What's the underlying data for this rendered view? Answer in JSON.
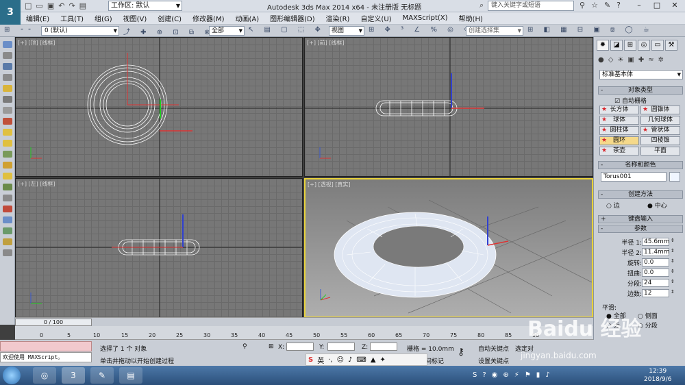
{
  "app": {
    "title": "Autodesk 3ds Max  2014 x64    - 未注册版    无标题",
    "workspace": "工作区: 默认",
    "search_placeholder": "键入关键字或短语"
  },
  "menu": [
    "编辑(E)",
    "工具(T)",
    "组(G)",
    "视图(V)",
    "创建(C)",
    "修改器(M)",
    "动画(A)",
    "图形编辑器(D)",
    "渲染(R)",
    "自定义(U)",
    "MAXScript(X)",
    "帮助(H)"
  ],
  "toolbar": {
    "layer": "0 (默认)",
    "selection_filter": "全部",
    "ref_coord": "视图",
    "named_selection": "创建选择集"
  },
  "viewports": {
    "top": "[+] [顶] [线框]",
    "front": "[+] [前] [线框]",
    "left": "[+] [左] [线框]",
    "persp": "[+] [透视] [真实]"
  },
  "timeline": {
    "frame": "0 / 100",
    "ticks": [
      "0",
      "5",
      "10",
      "15",
      "20",
      "25",
      "30",
      "35",
      "40",
      "45",
      "50",
      "55",
      "60",
      "65",
      "70",
      "75",
      "80",
      "85",
      "90"
    ]
  },
  "status": {
    "selected": "选择了 1 个 对象",
    "prompt": "单击并拖动以开始创建过程",
    "script_welcome": "欢迎使用 MAXScript。",
    "x_label": "X:",
    "y_label": "Y:",
    "z_label": "Z:",
    "grid": "栅格 = 10.0mm",
    "auto_key": "自动关键点",
    "set_key": "设置关键点",
    "selected_set": "选定对",
    "add_time_tag": "添加时间标记"
  },
  "panel": {
    "category": "标准基本体",
    "object_type_title": "对象类型",
    "auto_grid": "自动栅格",
    "object_buttons": [
      {
        "label": "长方体",
        "active": false
      },
      {
        "label": "圆锥体",
        "active": false
      },
      {
        "label": "球体",
        "active": false
      },
      {
        "label": "几何球体",
        "active": false
      },
      {
        "label": "圆柱体",
        "active": false
      },
      {
        "label": "管状体",
        "active": false
      },
      {
        "label": "圆环",
        "active": true
      },
      {
        "label": "四棱锥",
        "active": false
      },
      {
        "label": "茶壶",
        "active": false
      },
      {
        "label": "平面",
        "active": false
      }
    ],
    "name_color_title": "名称和颜色",
    "object_name": "Torus001",
    "creation_method_title": "创建方法",
    "edge": "边",
    "center": "中心",
    "keyboard_entry": "键盘输入",
    "parameters_title": "参数",
    "params": [
      {
        "label": "半径 1:",
        "value": "45.6mm"
      },
      {
        "label": "半径 2:",
        "value": "11.4mm"
      },
      {
        "label": "旋转:",
        "value": "0.0"
      },
      {
        "label": "扭曲:",
        "value": "0.0"
      },
      {
        "label": "分段:",
        "value": "24"
      },
      {
        "label": "边数:",
        "value": "12"
      }
    ],
    "smooth_title": "平滑:",
    "smooth_all": "全部",
    "smooth_side": "侧面",
    "smooth_none": "无",
    "smooth_segment": "分段"
  },
  "ime": {
    "label": "英"
  },
  "taskbar": {
    "time": "12:39",
    "date": "2018/9/6"
  },
  "watermark": {
    "brand": "Baidu 经验",
    "url": "jingyan.baidu.com"
  }
}
